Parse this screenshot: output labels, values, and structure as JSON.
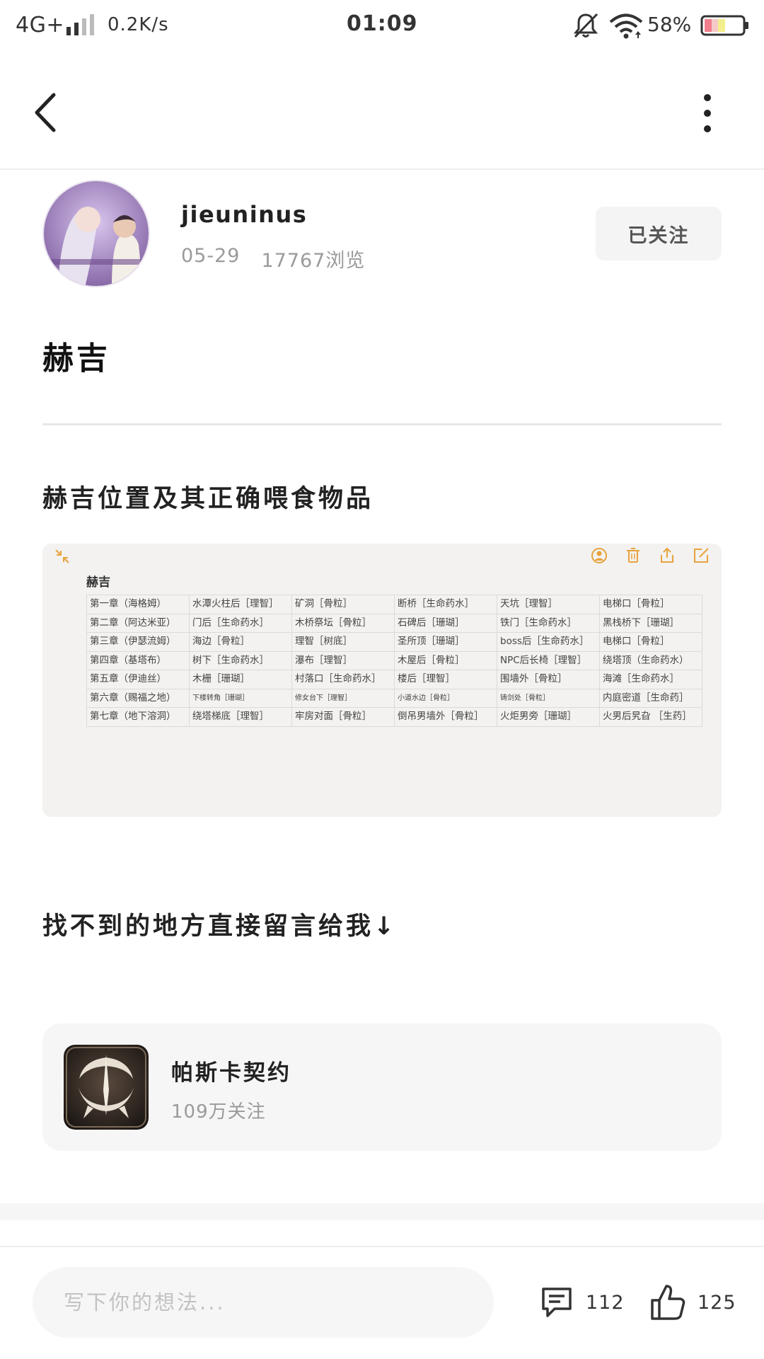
{
  "status_bar": {
    "network": "4G+",
    "speed": "0.2K/s",
    "time": "01:09",
    "battery": "58%",
    "icons": [
      "signal-icon",
      "bell-off-icon",
      "wifi-icon",
      "battery-icon"
    ]
  },
  "header": {
    "icons": [
      "back-arrow-icon",
      "more-vertical-icon"
    ]
  },
  "author": {
    "name": "jieuninus",
    "date": "05-29",
    "views": "17767浏览",
    "follow_label": "已关注"
  },
  "post": {
    "title": "赫吉",
    "subtitle": "赫吉位置及其正确喂食物品",
    "prompt": "找不到的地方直接留言给我↓"
  },
  "note_image": {
    "heading": "赫吉",
    "tool_icons": [
      "collapse-icon",
      "share-person-icon",
      "trash-icon",
      "upload-icon",
      "edit-icon"
    ],
    "rows": [
      [
        "第一章（海格姆）",
        "水潭火柱后［理智］",
        "矿洞［骨粒］",
        "断桥［生命药水］",
        "天坑［理智］",
        "电梯口［骨粒］"
      ],
      [
        "第二章（阿达米亚）",
        "门后［生命药水］",
        "木桥祭坛［骨粒］",
        "石碑后［珊瑚］",
        "铁门［生命药水］",
        "黑栈桥下［珊瑚］"
      ],
      [
        "第三章（伊瑟流姆）",
        "海边［骨粒］",
        "理智［树底］",
        "圣所顶［珊瑚］",
        "boss后［生命药水］",
        "电梯口［骨粒］"
      ],
      [
        "第四章（基塔布）",
        "树下［生命药水］",
        "瀑布［理智］",
        "木屋后［骨粒］",
        "NPC后长椅［理智］",
        "绕塔顶（生命药水）"
      ],
      [
        "第五章（伊迪丝）",
        "木栅［珊瑚］",
        "村落口［生命药水］",
        "楼后［理智］",
        "围墙外［骨粒］",
        "海滩［生命药水］"
      ],
      [
        "第六章（赐福之地）",
        "下楼转角［珊瑚］",
        "修女台下［理智］",
        "小道水边［骨粒］",
        "铸剑处［骨粒］",
        "内庭密道［生命药］"
      ],
      [
        "第七章（地下溶洞）",
        "绕塔梯底［理智］",
        "牢房对面［骨粒］",
        "倒吊男墙外［骨粒］",
        "火炬男旁［珊瑚］",
        "火男后旯旮 ［生药］"
      ]
    ]
  },
  "game_card": {
    "name": "帕斯卡契约",
    "followers": "109万关注",
    "icon": "game-logo-icon"
  },
  "bottom_bar": {
    "placeholder": "写下你的想法...",
    "comments": "112",
    "likes": "125",
    "icons": [
      "comment-icon",
      "thumbs-up-icon"
    ]
  },
  "colors": {
    "accent_orange": "#e8a33d",
    "muted_text": "#9a9a9a",
    "card_bg": "#f6f6f6"
  }
}
